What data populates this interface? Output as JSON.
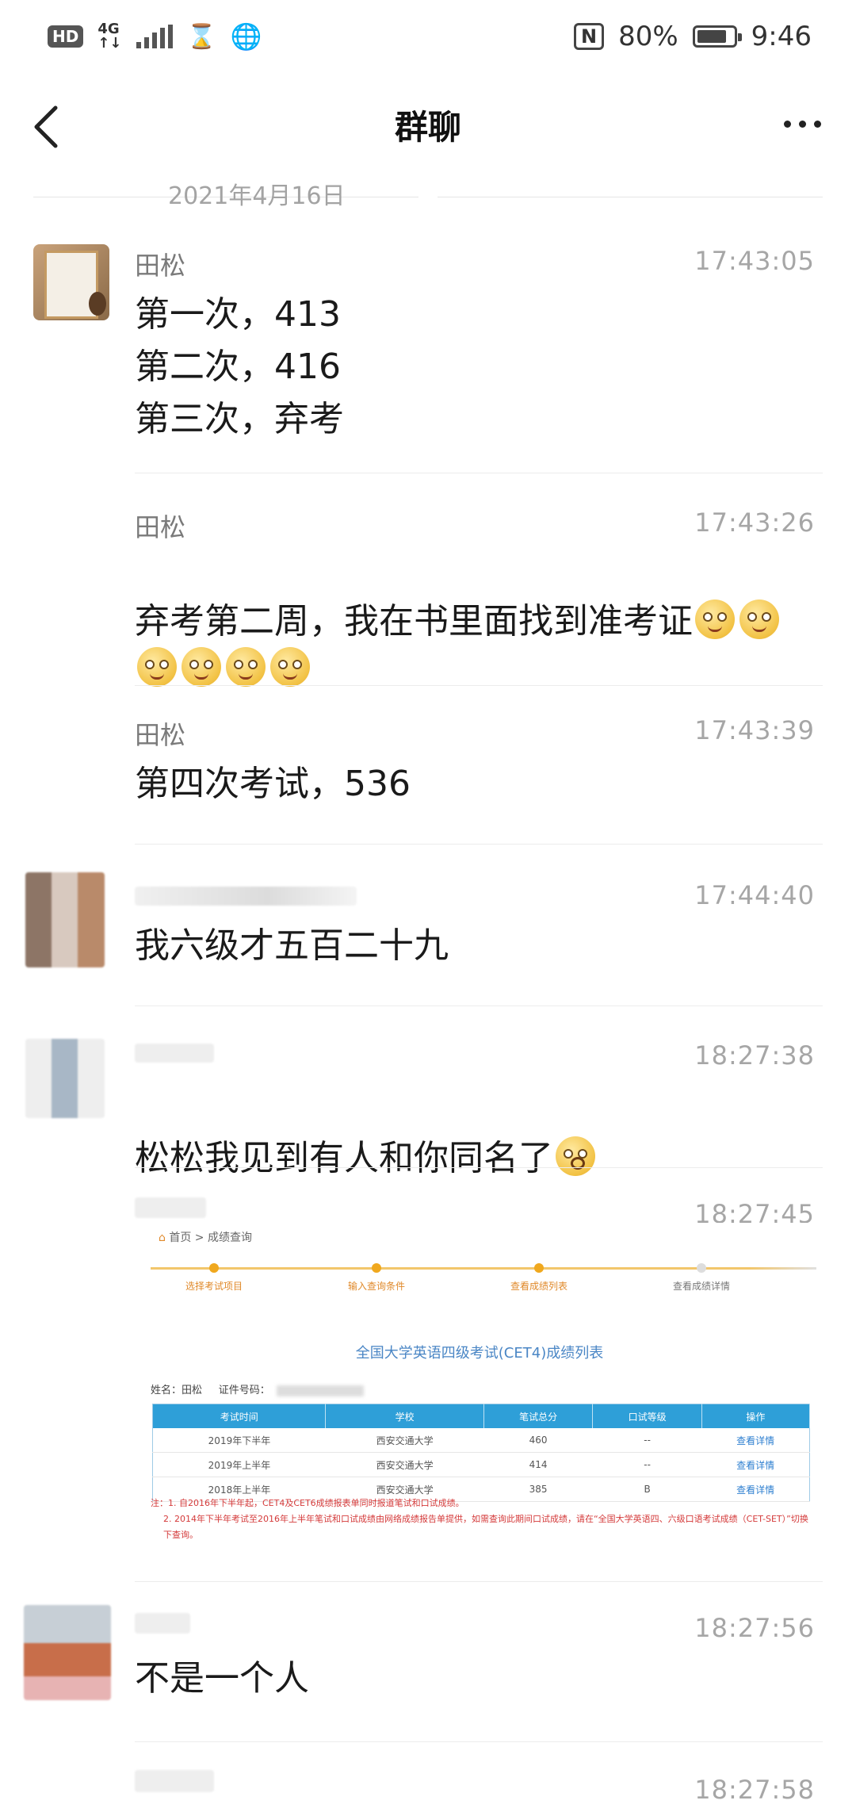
{
  "status_bar": {
    "hd": "HD",
    "network": "4G",
    "network_sub": "↑↓",
    "nfc": "N",
    "battery_text": "80%",
    "battery_level": 0.8,
    "clock": "9:46"
  },
  "nav": {
    "title": "群聊"
  },
  "date_separator": "2021年4月16日",
  "messages": [
    {
      "sender": "田松",
      "time": "17:43:05",
      "text": "第一次，413\n第二次，416\n第三次，弃考"
    },
    {
      "sender": "田松",
      "time": "17:43:26",
      "text_before": "弃考第二周，我在书里面找到准考证",
      "emoji_count": 6
    },
    {
      "sender": "田松",
      "time": "17:43:39",
      "text": "第四次考试，536"
    },
    {
      "sender": "",
      "time": "17:44:40",
      "text": "我六级才五百二十九"
    },
    {
      "sender": "",
      "time": "18:27:38",
      "text": "松松我见到有人和你同名了"
    },
    {
      "sender": "",
      "time": "18:27:45",
      "image": "score-screenshot"
    },
    {
      "sender": "",
      "time": "18:27:56",
      "text": "不是一个人"
    },
    {
      "sender": "",
      "time": "18:27:58"
    }
  ],
  "score_screenshot": {
    "breadcrumb": "首页 > 成绩查询",
    "steps": [
      "选择考试项目",
      "输入查询条件",
      "查看成绩列表",
      "查看成绩详情"
    ],
    "title": "全国大学英语四级考试(CET4)成绩列表",
    "name_label": "姓名：田松",
    "id_label": "证件号码：",
    "columns": [
      "考试时间",
      "学校",
      "笔试总分",
      "口试等级",
      "操作"
    ],
    "rows": [
      [
        "2019年下半年",
        "西安交通大学",
        "460",
        "--",
        "查看详情"
      ],
      [
        "2019年上半年",
        "西安交通大学",
        "414",
        "--",
        "查看详情"
      ],
      [
        "2018年上半年",
        "西安交通大学",
        "385",
        "B",
        "查看详情"
      ]
    ],
    "note_1": "注：1. 自2016年下半年起，CET4及CET6成绩报表单同时报道笔试和口试成绩。",
    "note_2": "2. 2014年下半年考试至2016年上半年笔试和口试成绩由网络成绩报告单提供，如需查询此期间口试成绩，请在“全国大学英语四、六级口语考试成绩（CET-SET）”切换下查询。"
  },
  "colors": {
    "time_text": "#a6a6a6",
    "sender_text": "#7a7a7a",
    "table_header": "#2e9fd8",
    "note_red": "#d43a3a"
  }
}
